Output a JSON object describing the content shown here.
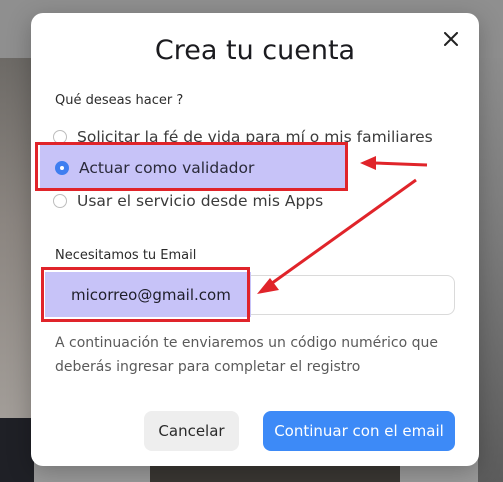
{
  "modal": {
    "title": "Crea tu cuenta",
    "close_icon": "close-icon"
  },
  "question": {
    "label": "Qué deseas hacer ?",
    "options": [
      {
        "label": "Solicitar la fé de vida para mí o mis familiares",
        "checked": false
      },
      {
        "label": "Actuar como validador",
        "checked": true
      },
      {
        "label": "Usar el servicio desde mis Apps",
        "checked": false
      }
    ]
  },
  "email": {
    "label": "Necesitamos tu Email",
    "value": "micorreo@gmail.com"
  },
  "helper_text": "A continuación te enviaremos un código numérico que deberás ingresar para completar el registro",
  "buttons": {
    "cancel": "Cancelar",
    "continue": "Continuar con el email"
  },
  "colors": {
    "annotation_red": "#e0242a",
    "highlight": "#c7c3f8",
    "primary": "#3d8af7"
  }
}
